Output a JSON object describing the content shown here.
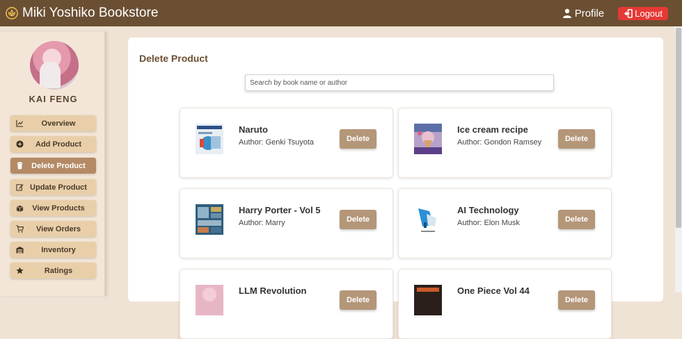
{
  "header": {
    "title": "Miki Yoshiko Bookstore",
    "brand_icon": "lotus-icon",
    "profile_label": "Profile",
    "logout_label": "Logout"
  },
  "sidebar": {
    "username": "KAI FENG",
    "items": [
      {
        "label": "Overview",
        "icon": "chart-line-icon"
      },
      {
        "label": "Add Product",
        "icon": "plus-circle-icon"
      },
      {
        "label": "Delete Product",
        "icon": "trash-icon",
        "active": true
      },
      {
        "label": "Update Product",
        "icon": "edit-icon"
      },
      {
        "label": "View Products",
        "icon": "boxes-icon"
      },
      {
        "label": "View Orders",
        "icon": "cart-icon"
      },
      {
        "label": "Inventory",
        "icon": "warehouse-icon"
      },
      {
        "label": "Ratings",
        "icon": "star-icon"
      }
    ]
  },
  "main": {
    "title": "Delete Product",
    "search_placeholder": "Search by book name or author",
    "delete_label": "Delete",
    "products": [
      {
        "title": "Naruto",
        "author": "Author: Genki Tsuyota"
      },
      {
        "title": "Ice cream recipe",
        "author": "Author: Gondon Ramsey"
      },
      {
        "title": "Harry Porter - Vol 5",
        "author": "Author: Marry"
      },
      {
        "title": "AI Technology",
        "author": "Author: Elon Musk"
      },
      {
        "title": "LLM Revolution",
        "author": ""
      },
      {
        "title": "One Piece Vol 44",
        "author": ""
      }
    ]
  },
  "colors": {
    "header_bg": "#6b4f33",
    "page_bg": "#efe3d6",
    "menu_item_bg": "#e8cfa9",
    "menu_item_active_bg": "#b48a65",
    "delete_button_bg": "#b49678",
    "logout_bg": "#e53935"
  }
}
